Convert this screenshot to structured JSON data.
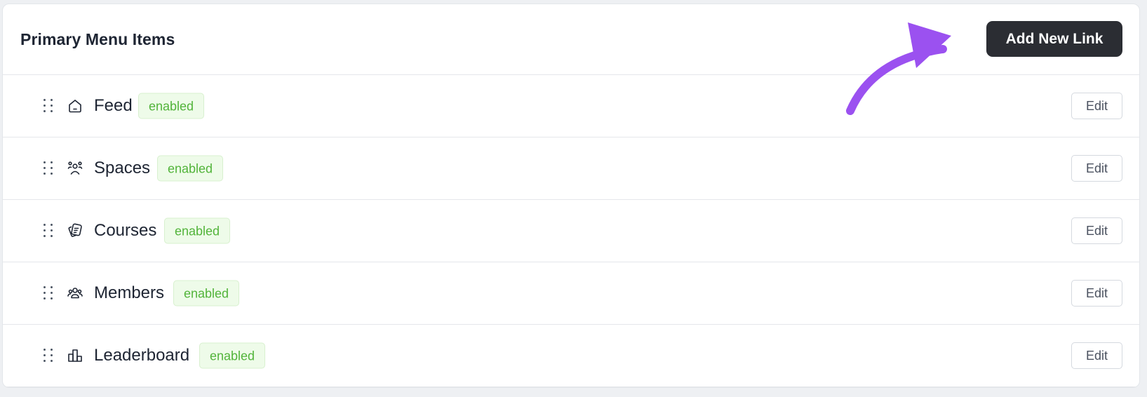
{
  "header": {
    "title": "Primary Menu Items",
    "add_button_label": "Add New Link"
  },
  "annotation": {
    "arrow_color": "#9b51f0"
  },
  "menu_items": [
    {
      "label": "Feed",
      "icon": "home-icon",
      "status": "enabled",
      "edit_label": "Edit"
    },
    {
      "label": "Spaces",
      "icon": "spaces-icon",
      "status": "enabled",
      "edit_label": "Edit"
    },
    {
      "label": "Courses",
      "icon": "courses-icon",
      "status": "enabled",
      "edit_label": "Edit"
    },
    {
      "label": "Members",
      "icon": "members-icon",
      "status": "enabled",
      "edit_label": "Edit"
    },
    {
      "label": "Leaderboard",
      "icon": "leaderboard-icon",
      "status": "enabled",
      "edit_label": "Edit"
    }
  ],
  "colors": {
    "badge_text": "#52b43a",
    "badge_bg": "#eefbe9",
    "primary_button_bg": "#2b2d33"
  }
}
